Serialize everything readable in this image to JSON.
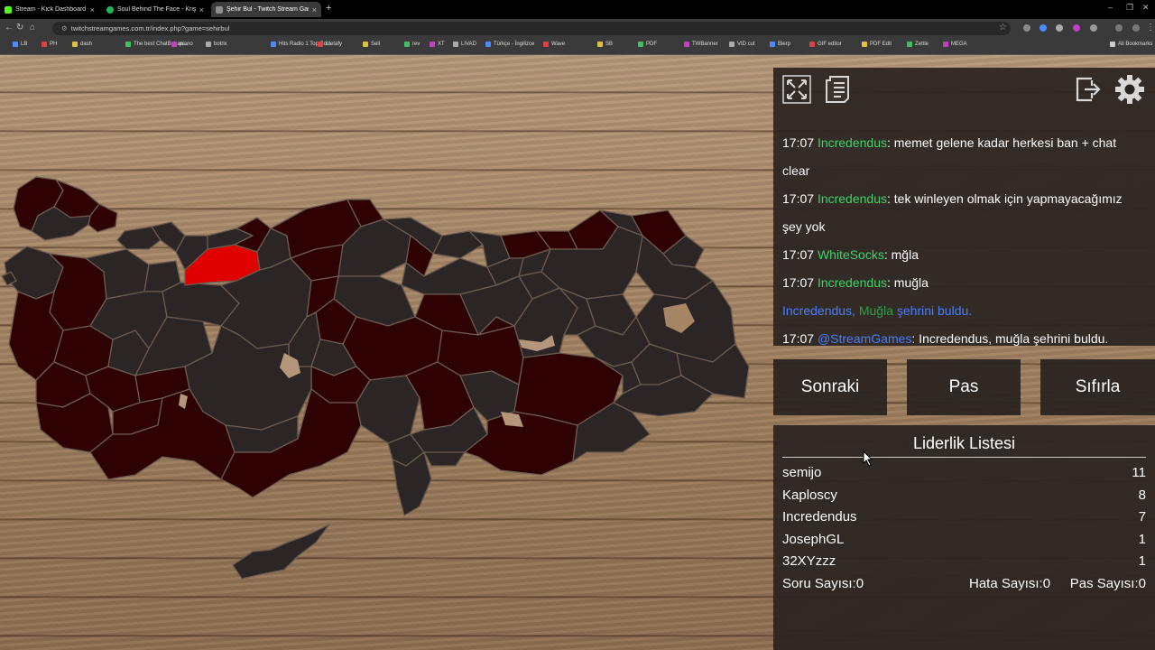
{
  "browser": {
    "tabs": [
      {
        "title": "Stream - Kick Dashboard",
        "color": "#53fc18"
      },
      {
        "title": "Soul Behind The Face - Kriş",
        "color": "#1db954"
      },
      {
        "title": "Şehir Bul - Twitch Stream Game",
        "color": "#8c8c8c"
      }
    ],
    "url": "twitchstreamgames.com.tr/index.php?game=sehirbul",
    "bookmarks": [
      "LB",
      "PH",
      "dash",
      "The best ChatBot an...",
      "piano",
      "botrix",
      "Hits Radio 1 Top So...",
      "Metafy",
      "Sell",
      "rev",
      "XT",
      "LIVAD",
      "Türkçe - İngilizce",
      "Wave",
      "SB",
      "PDF",
      "TWBanner",
      "VID cut",
      "Blerp",
      "GIF editor",
      "PDF Edit",
      "Zettle",
      "MEGA"
    ],
    "all_bookmarks": "All Bookmarks"
  },
  "toolbar": {
    "icons": [
      "fullscreen-icon",
      "notes-icon",
      "logout-icon",
      "gear-icon"
    ]
  },
  "chat": [
    {
      "time": "17:07",
      "user": "Incredendus",
      "text": ": memet gelene kadar herkesi ban + chat"
    },
    {
      "cont": "clear"
    },
    {
      "time": "17:07",
      "user": "Incredendus",
      "text": ": tek winleyen olmak için yapmayacağımız"
    },
    {
      "cont": "şey yok"
    },
    {
      "time": "17:07",
      "user": "WhiteSocks",
      "text": ": mğla"
    },
    {
      "time": "17:07",
      "user": "Incredendus",
      "text": ": muğla"
    },
    {
      "announce_user": "Incredendus, ",
      "announce_city": "Muğla",
      "announce_text": " şehrini buldu."
    },
    {
      "time": "17:07",
      "user": "@StreamGames",
      "text": ": Incredendus, muğla şehrini buldu.",
      "bot": true
    }
  ],
  "buttons": {
    "next": "Sonraki",
    "pass": "Pas",
    "reset": "Sıfırla"
  },
  "leaderboard": {
    "title": "Liderlik Listesi",
    "rows": [
      {
        "name": "semijo",
        "score": "11"
      },
      {
        "name": "Kaploscy",
        "score": "8"
      },
      {
        "name": "Incredendus",
        "score": "7"
      },
      {
        "name": "JosephGL",
        "score": "1"
      },
      {
        "name": "32XYzzz",
        "score": "1"
      }
    ]
  },
  "stats": {
    "questions": "Soru Sayısı:0",
    "errors": "Hata Sayısı:0",
    "passes": "Pas Sayısı:0"
  },
  "colors": {
    "province_default": "#2b2625",
    "province_found": "#2e0202",
    "province_highlight": "#e00000",
    "chat_user": "#3fd16a",
    "chat_bot": "#4a7cff"
  }
}
